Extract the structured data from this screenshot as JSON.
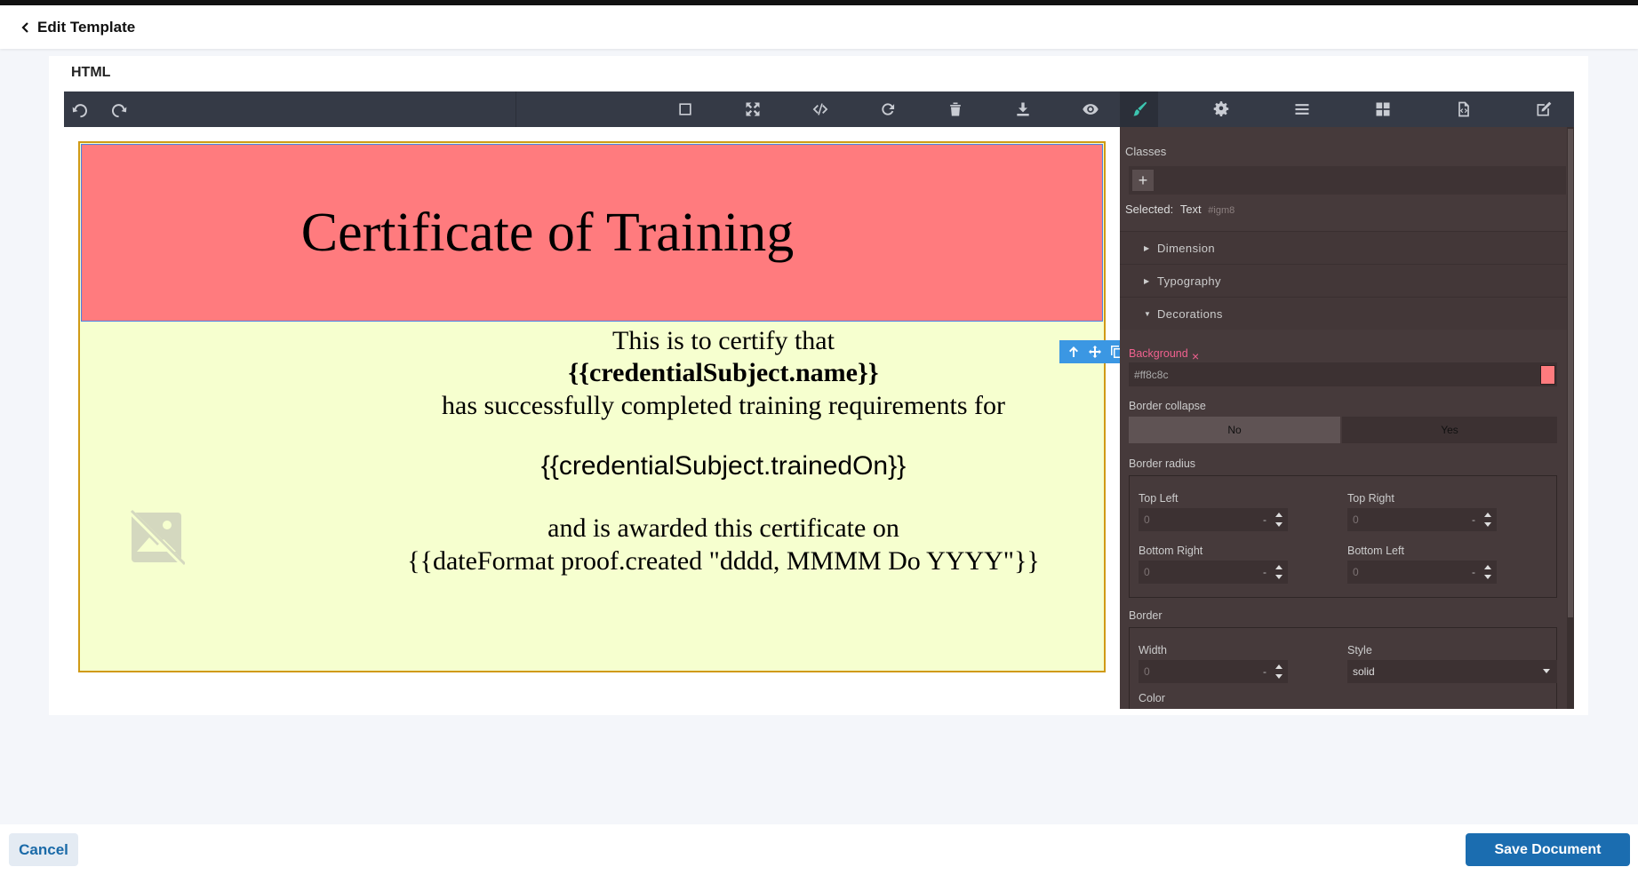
{
  "header": {
    "back_label": "Edit Template"
  },
  "card": {
    "title": "HTML"
  },
  "toolbar": {
    "left_icons": [
      "undo-icon",
      "redo-icon"
    ],
    "center_icons": [
      "square-outline-icon",
      "fullscreen-icon",
      "code-icon",
      "refresh-icon",
      "trash-icon",
      "download-icon",
      "eye-icon"
    ],
    "right_icons": [
      "paint-brush-icon",
      "gear-icon",
      "layers-icon",
      "blocks-icon",
      "code-file-icon",
      "edit-icon"
    ],
    "active_color": "#3cc5b0"
  },
  "certificate": {
    "title": "Certificate of Training",
    "line1": "This is to certify that",
    "line2": "{{credentialSubject.name}}",
    "line3": "has successfully completed training requirements for",
    "line4": "{{credentialSubject.trainedOn}}",
    "line5": "and is awarded this certificate on",
    "line6": "{{dateFormat proof.created \"dddd, MMMM Do YYYY\"}}",
    "header_bg": "#ff7b7e",
    "body_bg": "#f6ffcf",
    "border_color": "#d09a16"
  },
  "panel": {
    "classes_label": "Classes",
    "add_label": "+",
    "selected_label": "Selected:",
    "selected_type": "Text",
    "selected_id": "#igm8",
    "sectors": [
      "Dimension",
      "Typography",
      "Decorations"
    ],
    "background_label": "Background",
    "background_remove": "×",
    "background_value": "#ff8c8c",
    "border_collapse_label": "Border collapse",
    "border_collapse_options": [
      "No",
      "Yes"
    ],
    "border_collapse_selected": "No",
    "border_radius_label": "Border radius",
    "top_left_label": "Top Left",
    "top_right_label": "Top Right",
    "bottom_right_label": "Bottom Right",
    "bottom_left_label": "Bottom Left",
    "radius_value": "0",
    "unit": "-",
    "border_label": "Border",
    "width_label": "Width",
    "width_value": "0",
    "style_label": "Style",
    "style_value": "solid",
    "color_label": "Color"
  },
  "footer": {
    "cancel_label": "Cancel",
    "save_label": "Save Document"
  }
}
